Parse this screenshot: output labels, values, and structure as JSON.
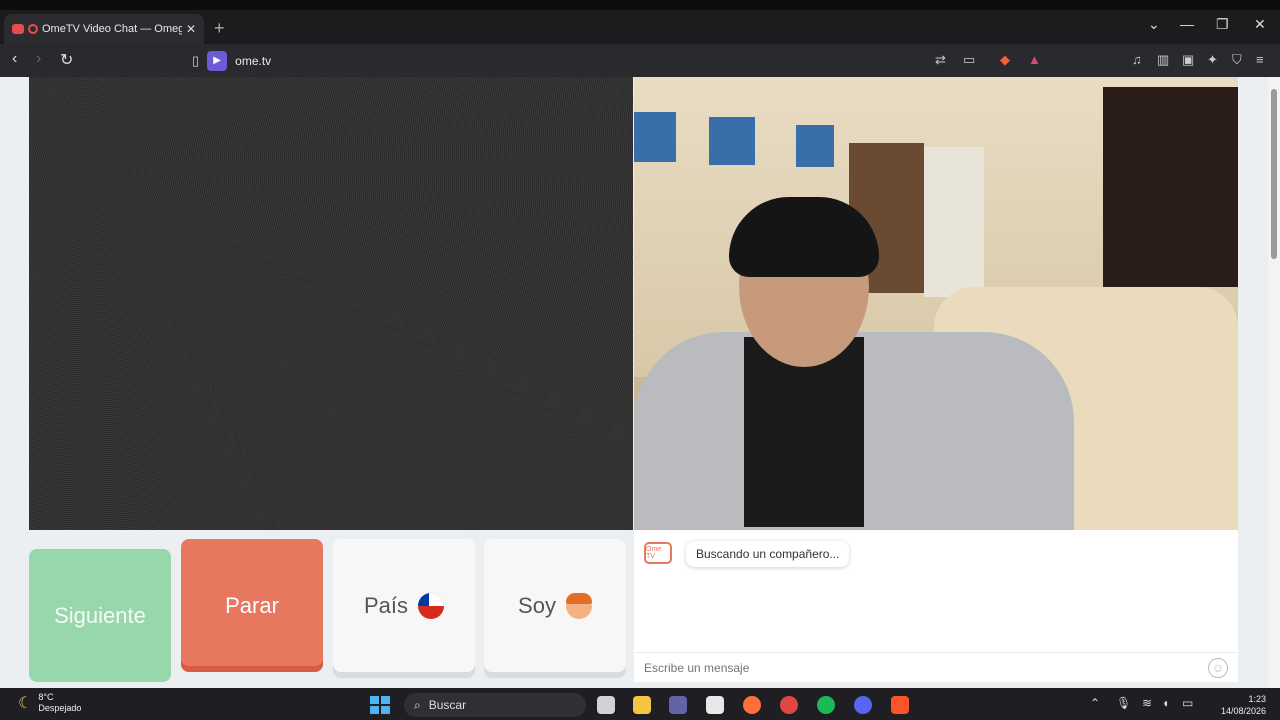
{
  "browser": {
    "tab_title": "OmeTV Video Chat — Omegle",
    "new_tab": "+",
    "url": "ome.tv",
    "window_controls": [
      "⌄",
      "—",
      "❐",
      "✕"
    ]
  },
  "chat_buttons": {
    "next_label": "Siguiente",
    "stop_label": "Parar",
    "country_label": "País",
    "gender_label": "Soy"
  },
  "chat": {
    "status_message": "Buscando un compañero...",
    "input_placeholder": "Escribe un mensaje",
    "logo_text": "Ome TV"
  },
  "taskbar": {
    "temperature": "8°C",
    "weather_desc": "Despejado",
    "search_label": "Buscar",
    "time": "1:23",
    "date": "14/08/2026"
  },
  "colors": {
    "next_button": "#98d6ac",
    "stop_button": "#e8775f",
    "accent": "#6b5bd6"
  }
}
